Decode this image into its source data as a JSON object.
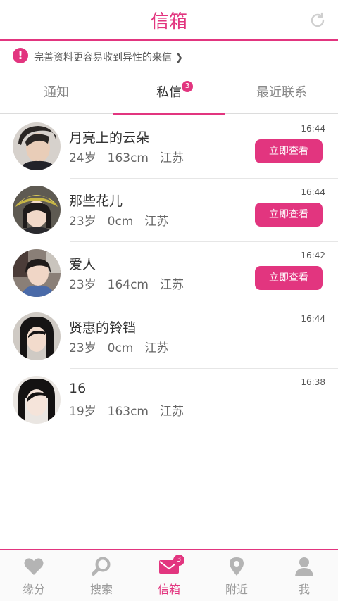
{
  "header": {
    "title": "信箱"
  },
  "notice": {
    "text": "完善资料更容易收到异性的来信 ❯"
  },
  "tabs": [
    {
      "label": "通知"
    },
    {
      "label": "私信",
      "badge": "3"
    },
    {
      "label": "最近联系"
    }
  ],
  "messages": [
    {
      "name": "月亮上的云朵",
      "age": "24岁",
      "height": "163cm",
      "region": "江苏",
      "time": "16:44",
      "button": "立即查看"
    },
    {
      "name": "那些花儿",
      "age": "23岁",
      "height": "0cm",
      "region": "江苏",
      "time": "16:44",
      "button": "立即查看"
    },
    {
      "name": "爱人",
      "age": "23岁",
      "height": "164cm",
      "region": "江苏",
      "time": "16:42",
      "button": "立即查看"
    },
    {
      "name": "贤惠的铃铛",
      "age": "23岁",
      "height": "0cm",
      "region": "江苏",
      "time": "16:44"
    },
    {
      "name": "16",
      "age": "19岁",
      "height": "163cm",
      "region": "江苏",
      "time": "16:38"
    }
  ],
  "bottom_nav": [
    {
      "label": "缘分",
      "icon": "heart-icon"
    },
    {
      "label": "搜索",
      "icon": "search-icon"
    },
    {
      "label": "信箱",
      "icon": "mail-icon",
      "badge": "3"
    },
    {
      "label": "附近",
      "icon": "location-pin-icon"
    },
    {
      "label": "我",
      "icon": "person-icon"
    }
  ]
}
